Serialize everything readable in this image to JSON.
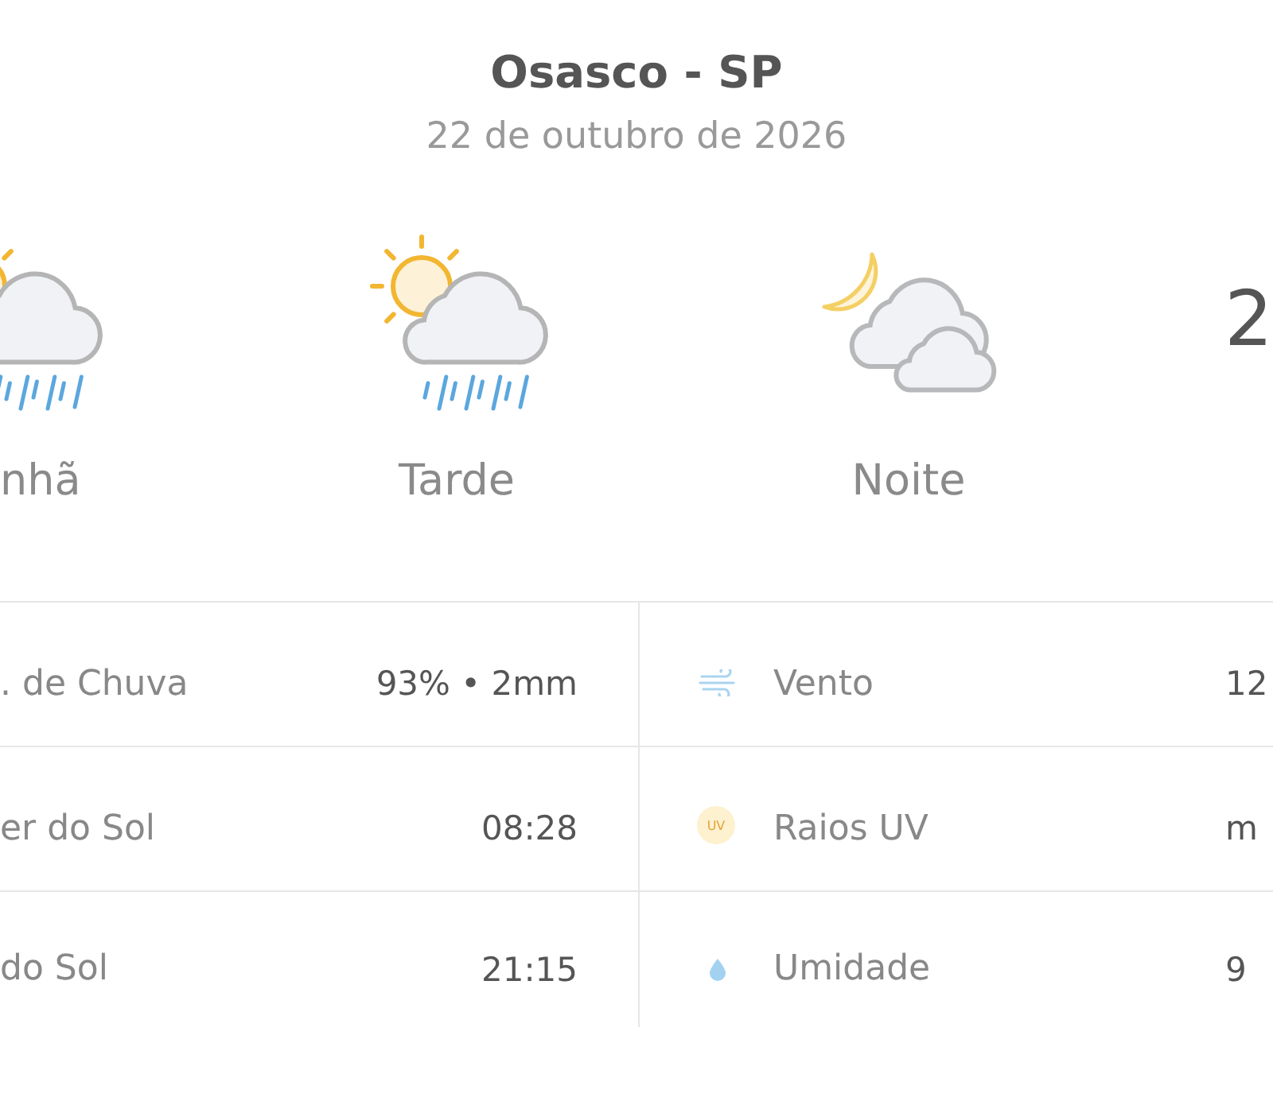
{
  "location": {
    "title": "Osasco - SP",
    "date": "22 de outubro de 2026"
  },
  "periods": [
    {
      "name": "nhã",
      "kind": "sun-cloud-rain"
    },
    {
      "name": "Tarde",
      "kind": "sun-cloud-rain"
    },
    {
      "name": "Noite",
      "kind": "moon-clouds"
    }
  ],
  "current": {
    "temperature": "2"
  },
  "details": {
    "left": [
      {
        "label": ". de Chuva",
        "value": "93% • 2mm"
      },
      {
        "label": "er do Sol",
        "value": "08:28"
      },
      {
        "label": "do Sol",
        "value": "21:15"
      }
    ],
    "right": [
      {
        "kind": "wind",
        "label": "Vento",
        "value": "12"
      },
      {
        "kind": "uv",
        "icon_text": "UV",
        "label": "Raios UV",
        "value": "m"
      },
      {
        "kind": "humidity",
        "label": "Umidade",
        "value": "9"
      }
    ]
  }
}
